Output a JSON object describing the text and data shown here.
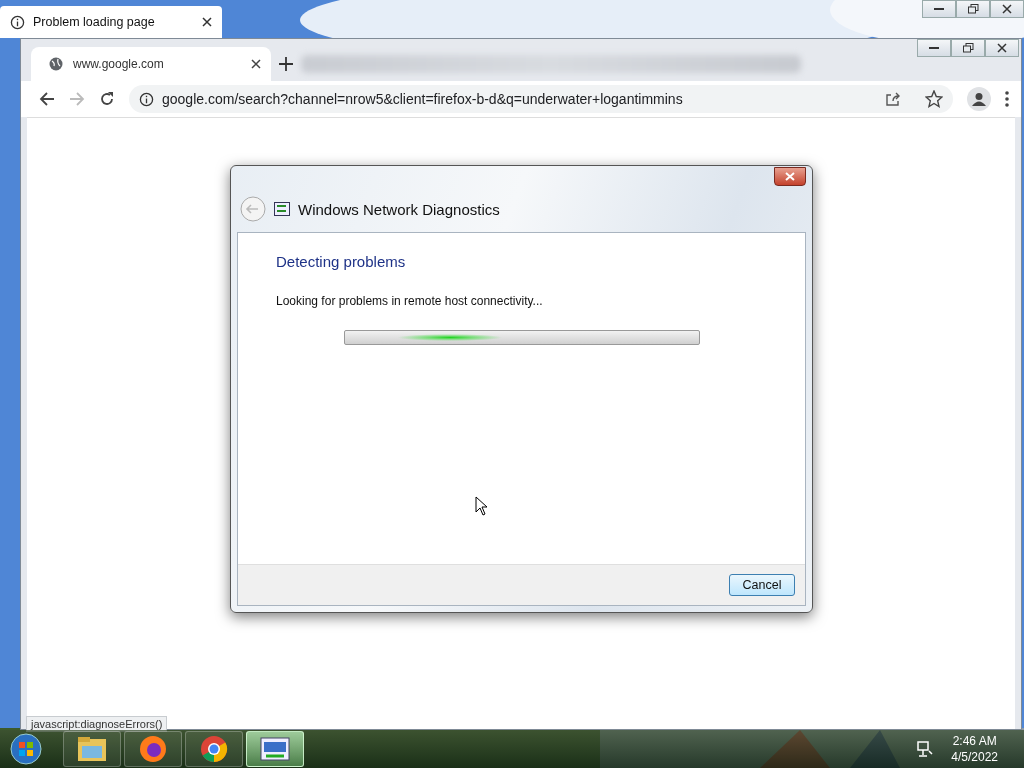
{
  "back_window": {
    "tab": {
      "title": "Problem loading page"
    },
    "status_tooltip": "javascript:diagnoseErrors()"
  },
  "browser": {
    "tab": {
      "title": "www.google.com"
    },
    "address": "google.com/search?channel=nrow5&client=firefox-b-d&q=underwater+logantimmins"
  },
  "dialog": {
    "title": "Windows Network Diagnostics",
    "heading": "Detecting problems",
    "progress": {
      "level": 0.45
    },
    "message": "Looking for problems in remote host connectivity...",
    "buttons": [
      "Cancel"
    ]
  },
  "taskbar": {
    "apps": [
      {
        "kind": "folder",
        "selected": false
      },
      {
        "kind": "firefox",
        "selected": false
      },
      {
        "kind": "chrome",
        "selected": false
      },
      {
        "kind": "diagnostics",
        "selected": true
      }
    ],
    "time": "2:46 AM",
    "date": "4/5/2022"
  }
}
